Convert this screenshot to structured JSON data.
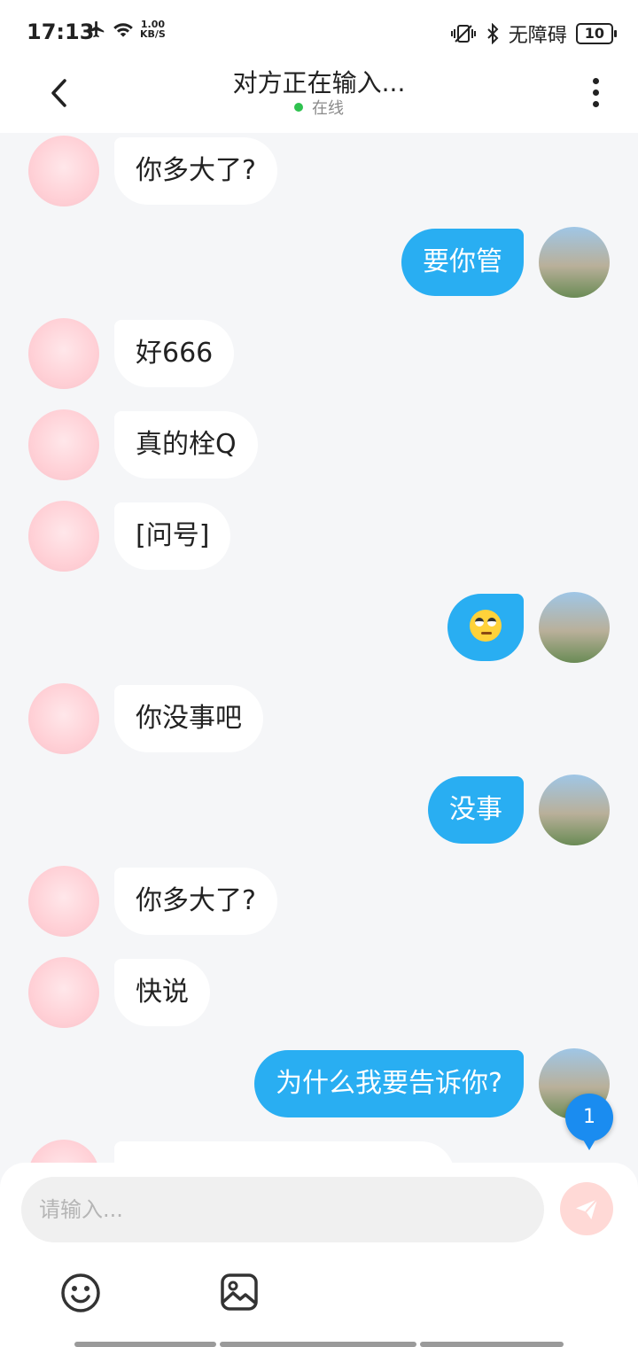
{
  "status_bar": {
    "time": "17:13",
    "net_speed_value": "1.00",
    "net_speed_unit": "KB/S",
    "accessibility": "无障碍",
    "battery": "10"
  },
  "header": {
    "title": "对方正在输入...",
    "status": "在线"
  },
  "messages": [
    {
      "side": "left",
      "text": "你多大了?"
    },
    {
      "side": "right",
      "text": "要你管"
    },
    {
      "side": "left",
      "text": "好666"
    },
    {
      "side": "left",
      "text": "真的栓Q"
    },
    {
      "side": "left",
      "text": "[问号]"
    },
    {
      "side": "right",
      "text": "",
      "emoji": "face-with-rolling-eyes"
    },
    {
      "side": "left",
      "text": "你没事吧"
    },
    {
      "side": "right",
      "text": "没事"
    },
    {
      "side": "left",
      "text": "你多大了?"
    },
    {
      "side": "left",
      "text": "快说"
    },
    {
      "side": "right",
      "text": "为什么我要告诉你?"
    }
  ],
  "unread_count": "1",
  "composer": {
    "placeholder": "请输入..."
  },
  "colors": {
    "accent": "#29aef2",
    "online": "#2fc24f",
    "send_button_bg": "#ffd9d6",
    "badge": "#1a8cf0"
  }
}
